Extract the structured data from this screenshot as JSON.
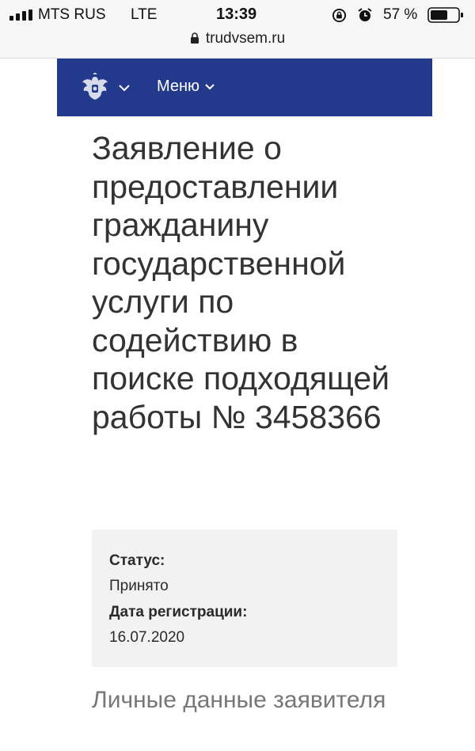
{
  "status_bar": {
    "carrier": "MTS RUS",
    "network": "LTE",
    "time": "13:39",
    "battery_percent": "57 %"
  },
  "browser": {
    "url": "trudvsem.ru"
  },
  "header": {
    "emblem_icon": "russian-coat-of-arms-icon",
    "menu_label": "Меню",
    "background_color": "#233a8c"
  },
  "main": {
    "title": "Заявление о предоставлении гражданину государственной услуги по содействию в поиске подходящей работы № 3458366",
    "status_label": "Статус:",
    "status_value": "Принято",
    "registration_label": "Дата регистрации:",
    "registration_value": "16.07.2020",
    "section_title": "Личные данные заявителя"
  }
}
